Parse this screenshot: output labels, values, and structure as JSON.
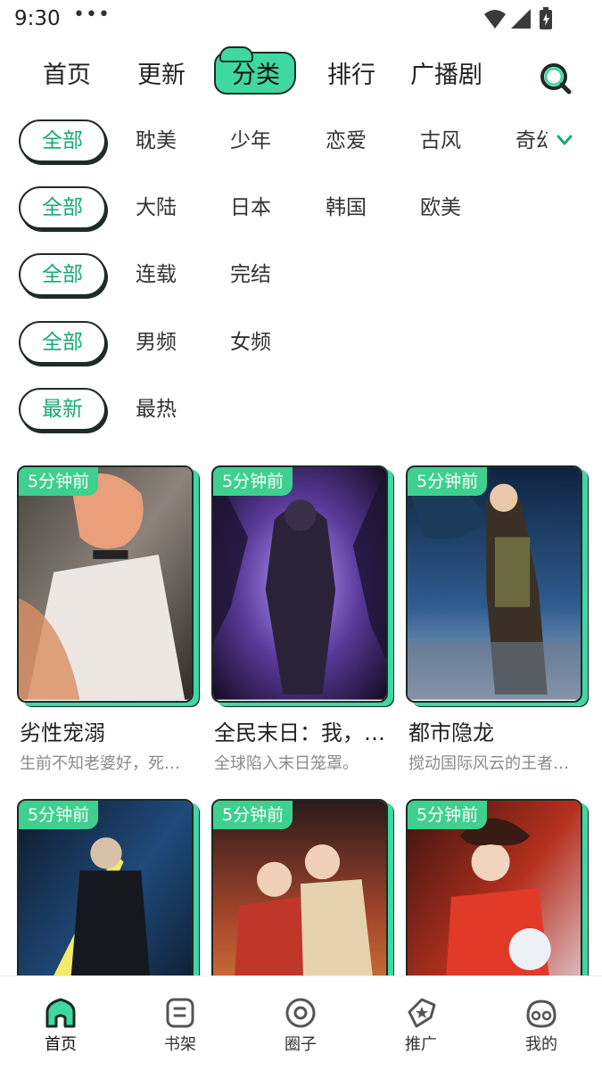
{
  "status_bar": {
    "time": "9:30",
    "dots": "•••"
  },
  "top_nav": {
    "tabs": [
      {
        "label": "首页"
      },
      {
        "label": "更新"
      },
      {
        "label": "分类"
      },
      {
        "label": "排行"
      },
      {
        "label": "广播剧"
      }
    ],
    "active_tab": "分类"
  },
  "filters": [
    {
      "selected": "全部",
      "options": [
        "耽美",
        "少年",
        "恋爱",
        "古风",
        "奇幻"
      ]
    },
    {
      "selected": "全部",
      "options": [
        "大陆",
        "日本",
        "韩国",
        "欧美"
      ]
    },
    {
      "selected": "全部",
      "options": [
        "连载",
        "完结"
      ]
    },
    {
      "selected": "全部",
      "options": [
        "男频",
        "女频"
      ]
    },
    {
      "selected": "最新",
      "options": [
        "最热"
      ]
    }
  ],
  "comics": [
    {
      "badge": "5分钟前",
      "title": "劣性宠溺",
      "desc": "生前不知老婆好，死后追妻火葬场"
    },
    {
      "badge": "5分钟前",
      "title": "全民末日：我，天灾",
      "desc": "全球陷入末日笼罩。"
    },
    {
      "badge": "5分钟前",
      "title": "都市隐龙",
      "desc": "搅动国际风云的王者归来"
    },
    {
      "badge": "5分钟前",
      "title": "",
      "desc": ""
    },
    {
      "badge": "5分钟前",
      "title": "",
      "desc": ""
    },
    {
      "badge": "5分钟前",
      "title": "",
      "desc": ""
    }
  ],
  "bottom_nav": [
    {
      "label": "首页",
      "icon": "home-icon"
    },
    {
      "label": "书架",
      "icon": "bookshelf-icon"
    },
    {
      "label": "圈子",
      "icon": "circle-icon"
    },
    {
      "label": "推广",
      "icon": "promote-icon"
    },
    {
      "label": "我的",
      "icon": "profile-icon"
    }
  ],
  "colors": {
    "accent": "#3fd8a2",
    "badge": "#3fcf8e",
    "chip_text": "#18a877"
  }
}
